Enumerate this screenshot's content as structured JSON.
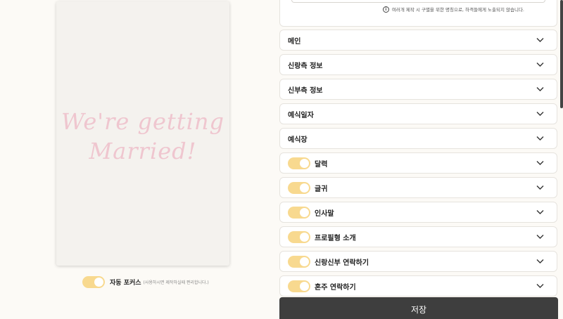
{
  "preview": {
    "script_line1": "We're getting",
    "script_line2": "Married!"
  },
  "auto_focus": {
    "label": "자동 포커스",
    "hint": "(사용하시면 제작하실때 편리합니다.)",
    "enabled": true
  },
  "notice": {
    "icon": "info-icon",
    "text": "여러개 제작 시 구별을 위한 명칭으로, 하객들에게 노출되지 않습니다."
  },
  "sections": [
    {
      "label": "메인",
      "has_toggle": false
    },
    {
      "label": "신랑측 정보",
      "has_toggle": false
    },
    {
      "label": "신부측 정보",
      "has_toggle": false
    },
    {
      "label": "예식일자",
      "has_toggle": false
    },
    {
      "label": "예식장",
      "has_toggle": false
    },
    {
      "label": "달력",
      "has_toggle": true,
      "enabled": true
    },
    {
      "label": "글귀",
      "has_toggle": true,
      "enabled": true
    },
    {
      "label": "인사말",
      "has_toggle": true,
      "enabled": true
    },
    {
      "label": "프로필형 소개",
      "has_toggle": true,
      "enabled": true
    },
    {
      "label": "신랑신부 연락하기",
      "has_toggle": true,
      "enabled": true
    },
    {
      "label": "혼주 연락하기",
      "has_toggle": true,
      "enabled": true
    }
  ],
  "save_label": "저장",
  "colors": {
    "toggle_on": "#f8d98f",
    "script_text": "#efc6cf",
    "save_button": "#3e3e3e"
  }
}
